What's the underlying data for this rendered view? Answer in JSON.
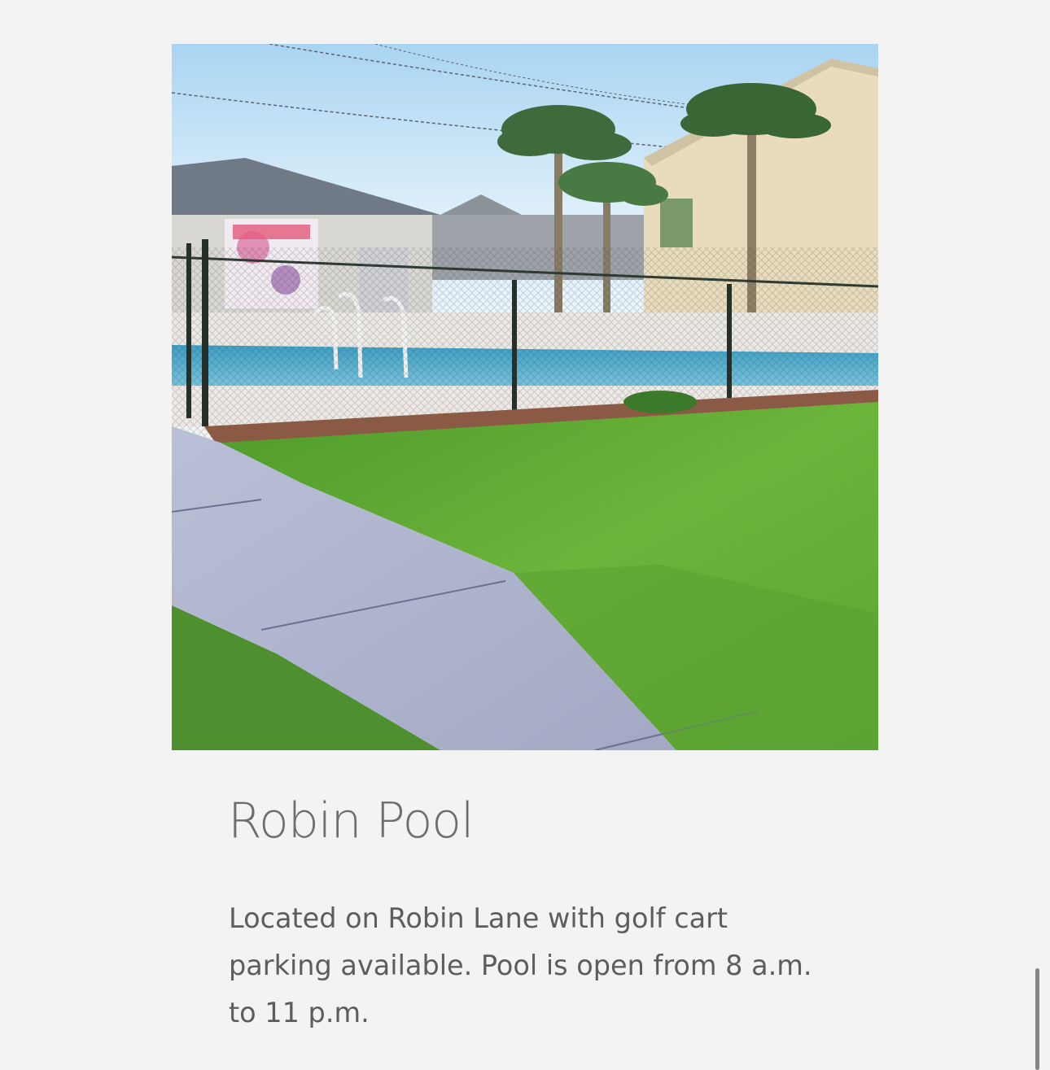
{
  "amenity": {
    "title": "Robin Pool",
    "description": "Located on Robin Lane with golf cart parking available. Pool is open from 8 a.m. to 11 p.m."
  },
  "colors": {
    "page_background": "#f3f3f4",
    "title_text": "#6d6d6d",
    "body_text": "#5d5d5d",
    "scrollbar": "#858585"
  }
}
